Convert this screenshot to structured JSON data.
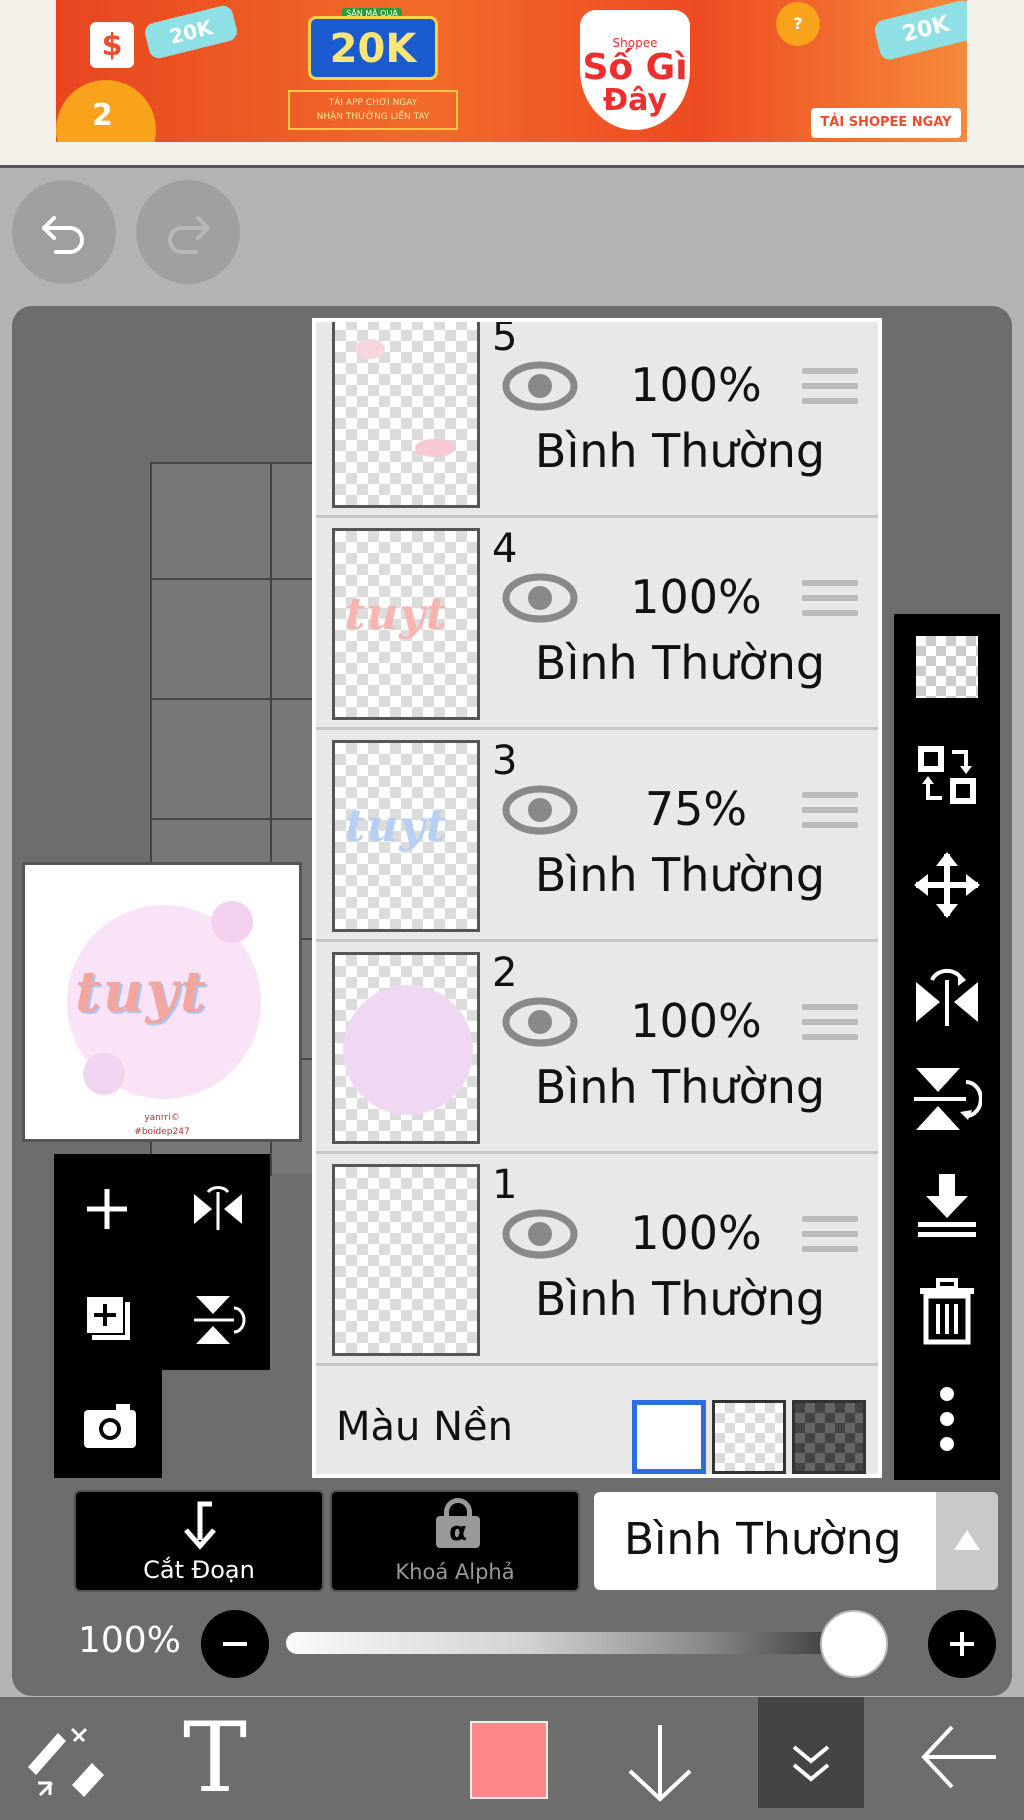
{
  "ad": {
    "badge_top": "SĂN MÃ QUÀ",
    "amount": "20K",
    "sub_line1": "TẢI APP CHƠI NGAY",
    "sub_line2": "NHẬN THƯỞNG LIỀN TAY",
    "chip_left": "20K",
    "chip_right": "20K",
    "ball_number": "2",
    "brand_small": "Shopee",
    "brand_line1": "Số Gì",
    "brand_line2": "Đây",
    "cta": "TẢI SHOPEE NGAY",
    "colors": {
      "bg": "#ee4d2d",
      "accent": "#f9a21b"
    }
  },
  "header": {
    "undo_icon": "undo-icon",
    "redo_icon": "redo-icon"
  },
  "preview": {
    "artwork_text": "tuyt",
    "caption1": "yanrri©",
    "caption2": "#boidep247"
  },
  "layers": [
    {
      "number": "5",
      "opacity": "100%",
      "mode": "Bình Thường",
      "thumb_text": ""
    },
    {
      "number": "4",
      "opacity": "100%",
      "mode": "Bình Thường",
      "thumb_text": "tuyt"
    },
    {
      "number": "3",
      "opacity": "75%",
      "mode": "Bình Thường",
      "thumb_text": "tuyt"
    },
    {
      "number": "2",
      "opacity": "100%",
      "mode": "Bình Thường",
      "thumb_text": ""
    },
    {
      "number": "1",
      "opacity": "100%",
      "mode": "Bình Thường",
      "thumb_text": ""
    }
  ],
  "background": {
    "label": "Màu Nền",
    "selected": "white",
    "options": [
      "white",
      "transparent",
      "dark-checker"
    ]
  },
  "right_tools": [
    "checker-icon",
    "swap-icon",
    "move-icon",
    "flip-horizontal-icon",
    "flip-vertical-icon",
    "merge-down-icon",
    "trash-icon",
    "more-icon"
  ],
  "controls": {
    "clip_label": "Cắt Đoạn",
    "alpha_lock_label": "Khoá Alphả",
    "alpha_symbol": "α",
    "blend_mode": "Bình Thường",
    "opacity_label": "100%",
    "opacity_value": 1.0
  },
  "bottom_bar": {
    "text_tool": "T",
    "brush_color": "#ff8787"
  }
}
